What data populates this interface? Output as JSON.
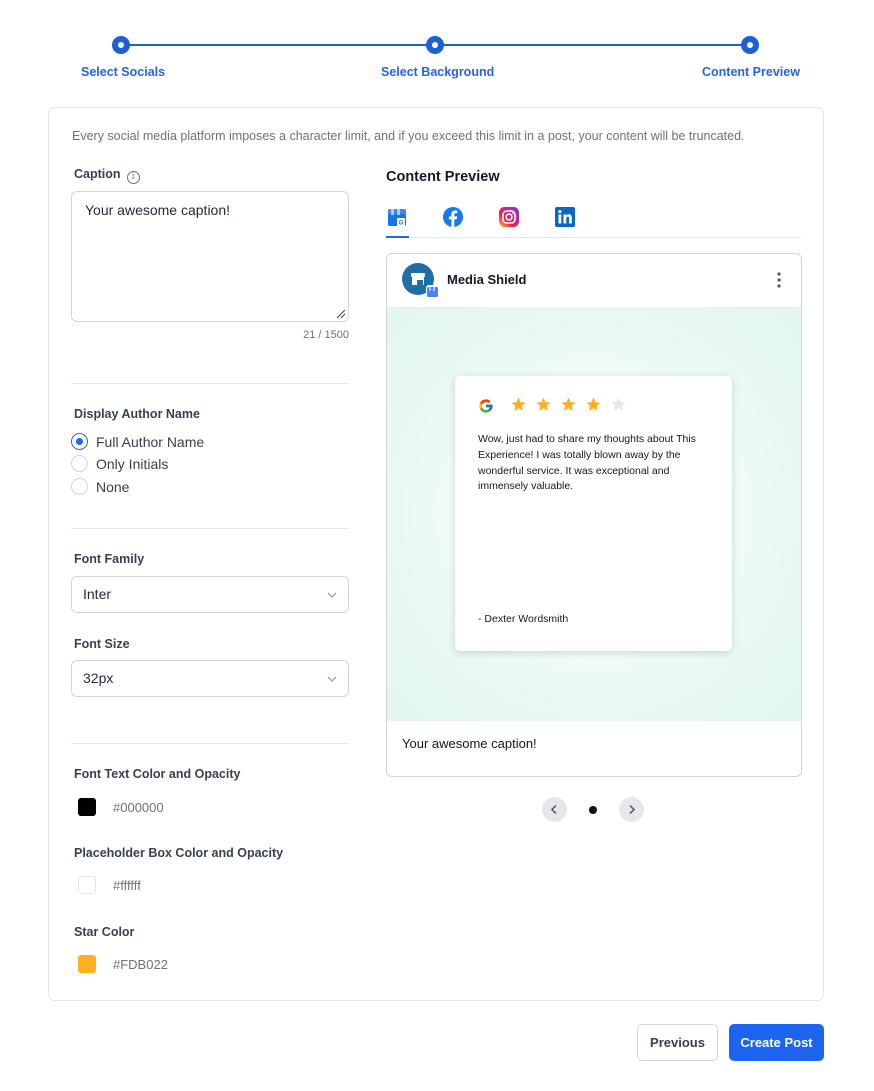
{
  "stepper": {
    "steps": [
      {
        "label": "Select Socials"
      },
      {
        "label": "Select Background"
      },
      {
        "label": "Content Preview"
      }
    ]
  },
  "notice": "Every social media platform imposes a character limit, and if you exceed this limit in a post, your content will be truncated.",
  "caption": {
    "label": "Caption",
    "value": "Your awesome caption!",
    "counter": "21 / 1500"
  },
  "author": {
    "label": "Display Author Name",
    "options": [
      "Full Author Name",
      "Only Initials",
      "None"
    ],
    "selected": "Full Author Name"
  },
  "font_family": {
    "label": "Font Family",
    "value": "Inter"
  },
  "font_size": {
    "label": "Font Size",
    "value": "32px"
  },
  "colors": {
    "text": {
      "label": "Font Text Color and Opacity",
      "value": "#000000"
    },
    "box": {
      "label": "Placeholder Box Color and Opacity",
      "value": "#ffffff"
    },
    "star": {
      "label": "Star Color",
      "value": "#FDB022"
    }
  },
  "preview": {
    "title": "Content Preview",
    "tabs": [
      "google-business-icon",
      "facebook-icon",
      "instagram-icon",
      "linkedin-icon"
    ],
    "active_tab": "google-business-icon",
    "account_name": "Media Shield",
    "review": {
      "rating": 4,
      "max_rating": 5,
      "text": "Wow, just had to share my thoughts about This Experience! I was totally blown away by the wonderful service. It was exceptional and immensely valuable.",
      "author": "- Dexter Wordsmith"
    },
    "caption": "Your awesome caption!"
  },
  "buttons": {
    "previous": "Previous",
    "create": "Create Post"
  },
  "theme": {
    "primary": "#2563eb",
    "star": "#FDB022"
  }
}
